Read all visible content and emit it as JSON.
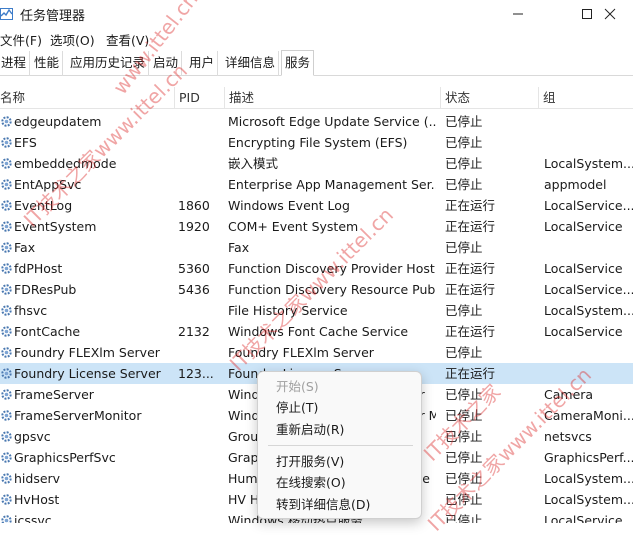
{
  "window": {
    "title": "任务管理器",
    "icon": "task-manager-icon",
    "controls": [
      "minimize",
      "maximize",
      "close"
    ]
  },
  "menu": [
    "文件(F)",
    "选项(O)",
    "查看(V)"
  ],
  "tabs": [
    "进程",
    "性能",
    "应用历史记录",
    "启动",
    "用户",
    "详细信息",
    "服务"
  ],
  "active_tab": "服务",
  "columns": {
    "name": "名称",
    "pid": "PID",
    "desc": "描述",
    "status": "状态",
    "group": "组"
  },
  "services": [
    {
      "name": "edgeupdatem",
      "pid": "",
      "desc": "Microsoft Edge Update Service (...",
      "status": "已停止",
      "group": ""
    },
    {
      "name": "EFS",
      "pid": "",
      "desc": "Encrypting File System (EFS)",
      "status": "已停止",
      "group": ""
    },
    {
      "name": "embeddedmode",
      "pid": "",
      "desc": "嵌入模式",
      "status": "已停止",
      "group": "LocalSystem..."
    },
    {
      "name": "EntAppSvc",
      "pid": "",
      "desc": "Enterprise App Management Ser...",
      "status": "已停止",
      "group": "appmodel"
    },
    {
      "name": "EventLog",
      "pid": "1860",
      "desc": "Windows Event Log",
      "status": "正在运行",
      "group": "LocalService..."
    },
    {
      "name": "EventSystem",
      "pid": "1920",
      "desc": "COM+ Event System",
      "status": "正在运行",
      "group": "LocalService"
    },
    {
      "name": "Fax",
      "pid": "",
      "desc": "Fax",
      "status": "已停止",
      "group": ""
    },
    {
      "name": "fdPHost",
      "pid": "5360",
      "desc": "Function Discovery Provider Host",
      "status": "正在运行",
      "group": "LocalService"
    },
    {
      "name": "FDResPub",
      "pid": "5436",
      "desc": "Function Discovery Resource Pub...",
      "status": "正在运行",
      "group": "LocalService..."
    },
    {
      "name": "fhsvc",
      "pid": "",
      "desc": "File History Service",
      "status": "已停止",
      "group": "LocalSystem..."
    },
    {
      "name": "FontCache",
      "pid": "2132",
      "desc": "Windows Font Cache Service",
      "status": "正在运行",
      "group": "LocalService"
    },
    {
      "name": "Foundry FLEXlm Server",
      "pid": "",
      "desc": "Foundry FLEXlm Server",
      "status": "已停止",
      "group": ""
    },
    {
      "name": "Foundry License Server",
      "pid": "123...",
      "desc": "Foundry License Server",
      "status": "正在运行",
      "group": ""
    },
    {
      "name": "FrameServer",
      "pid": "",
      "desc": "Windows Camera Frame Server",
      "status": "已停止",
      "group": "Camera"
    },
    {
      "name": "FrameServerMonitor",
      "pid": "",
      "desc": "Windows Camera Frame Server M...",
      "status": "已停止",
      "group": "CameraMoni..."
    },
    {
      "name": "gpsvc",
      "pid": "",
      "desc": "Group Policy Client",
      "status": "已停止",
      "group": "netsvcs"
    },
    {
      "name": "GraphicsPerfSvc",
      "pid": "",
      "desc": "GraphicsPerfSvc",
      "status": "已停止",
      "group": "GraphicsPerf..."
    },
    {
      "name": "hidserv",
      "pid": "",
      "desc": "Human Interface Device Service",
      "status": "已停止",
      "group": "LocalSystem..."
    },
    {
      "name": "HvHost",
      "pid": "",
      "desc": "HV Host Service",
      "status": "已停止",
      "group": "LocalSystem..."
    },
    {
      "name": "icssvc",
      "pid": "",
      "desc": "Windows 移动热点服务",
      "status": "已停止",
      "group": "LocalService..."
    }
  ],
  "selected_service": "Foundry License Server",
  "context_menu": {
    "items": [
      {
        "label": "开始(S)",
        "enabled": false
      },
      {
        "label": "停止(T)",
        "enabled": true
      },
      {
        "label": "重新启动(R)",
        "enabled": true
      },
      {
        "label": "打开服务(V)",
        "enabled": true
      },
      {
        "label": "在线搜索(O)",
        "enabled": true
      },
      {
        "label": "转到详细信息(D)",
        "enabled": true
      }
    ]
  },
  "watermarks": [
    "www.ittel.cn",
    "IT技术之家www.ittel.cn",
    "IT技术之家www.ittel.cn",
    "IT技术之家www.ittel.cn",
    "IT技术之家"
  ],
  "colors": {
    "selected_row": "#cce4f7",
    "watermark": "#dc2828",
    "gear": "#4a78b0"
  }
}
